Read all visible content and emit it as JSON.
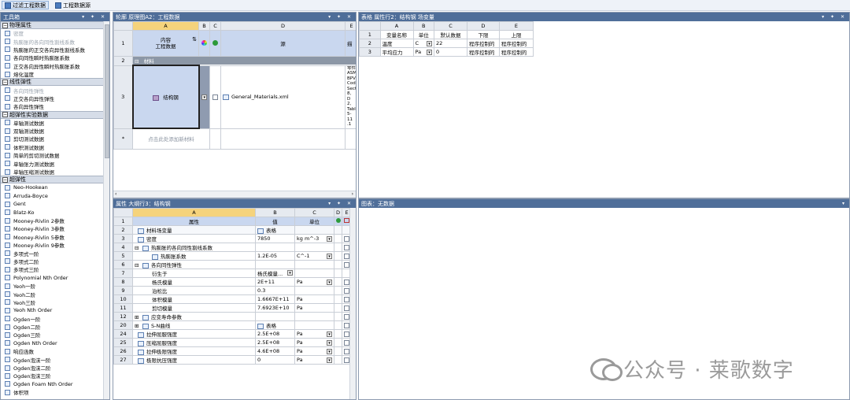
{
  "toolbar": {
    "filter_label": "过滤工程数据",
    "source_label": "工程数据源"
  },
  "toolbox": {
    "title": "工具箱",
    "controls": "▾ ✦ ✕",
    "categories": [
      {
        "label": "物理属性",
        "items": [
          {
            "label": "密度",
            "dim": true
          },
          {
            "label": "热膨胀的各向同性割线系数",
            "dim": true
          },
          {
            "label": "热膨胀的正交各向异性割线系数",
            "dim": false
          },
          {
            "label": "各向同性瞬时热膨胀系数",
            "dim": false
          },
          {
            "label": "正交各向异性瞬时热膨胀系数",
            "dim": false
          },
          {
            "label": "熔化温度",
            "dim": false
          }
        ]
      },
      {
        "label": "线性弹性",
        "items": [
          {
            "label": "各向同性弹性",
            "dim": true
          },
          {
            "label": "正交各向异性弹性",
            "dim": false
          },
          {
            "label": "各向异性弹性",
            "dim": false
          }
        ]
      },
      {
        "label": "超弹性实验数据",
        "items": [
          {
            "label": "单轴测试数据",
            "dim": false
          },
          {
            "label": "双轴测试数据",
            "dim": false
          },
          {
            "label": "剪切测试数据",
            "dim": false
          },
          {
            "label": "体积测试数据",
            "dim": false
          },
          {
            "label": "简单的剪切测试数据",
            "dim": false
          },
          {
            "label": "单轴张力测试数据",
            "dim": false
          },
          {
            "label": "单轴压缩测试数据",
            "dim": false
          }
        ]
      },
      {
        "label": "超弹性",
        "items": [
          {
            "label": "Neo-Hookean",
            "dim": false
          },
          {
            "label": "Arruda-Boyce",
            "dim": false
          },
          {
            "label": "Gent",
            "dim": false
          },
          {
            "label": "Blatz-Ko",
            "dim": false
          },
          {
            "label": "Mooney-Rivlin 2参数",
            "dim": false
          },
          {
            "label": "Mooney-Rivlin 3参数",
            "dim": false
          },
          {
            "label": "Mooney-Rivlin 5参数",
            "dim": false
          },
          {
            "label": "Mooney-Rivlin 9参数",
            "dim": false
          },
          {
            "label": "多项式一阶",
            "dim": false
          },
          {
            "label": "多项式二阶",
            "dim": false
          },
          {
            "label": "多项式三阶",
            "dim": false
          },
          {
            "label": "Polynomial Nth Order",
            "dim": false
          },
          {
            "label": "Yeoh一阶",
            "dim": false
          },
          {
            "label": "Yeoh二阶",
            "dim": false
          },
          {
            "label": "Yeoh三阶",
            "dim": false
          },
          {
            "label": "Yeoh Nth Order",
            "dim": false
          },
          {
            "label": "Ogden一阶",
            "dim": false
          },
          {
            "label": "Ogden二阶",
            "dim": false
          },
          {
            "label": "Ogden三阶",
            "dim": false
          },
          {
            "label": "Ogden Nth Order",
            "dim": false
          },
          {
            "label": "响应函数",
            "dim": false
          },
          {
            "label": "Ogden泡沫一阶",
            "dim": false
          },
          {
            "label": "Ogden泡沫二阶",
            "dim": false
          },
          {
            "label": "Ogden泡沫三阶",
            "dim": false
          },
          {
            "label": "Ogden Foam Nth Order",
            "dim": false
          },
          {
            "label": "体积项",
            "dim": false
          }
        ]
      }
    ]
  },
  "outline": {
    "title": "轮廓 原理图A2：工程数据",
    "controls": "▾ ✦ ✕",
    "cols": [
      "A",
      "B",
      "C",
      "D",
      "E"
    ],
    "header_row": {
      "num": "1",
      "content": "内容\n工程数据",
      "source": "源",
      "desc": "描"
    },
    "row2": {
      "num": "2",
      "label": "材料"
    },
    "row3": {
      "num": "3",
      "material": "结构钢",
      "file": "General_Materials.xml",
      "desc": "零件 ASM BPV Cod Sect 8, D 2, Tabl 5-11 .1"
    },
    "row_add": {
      "num": "*",
      "placeholder": "点击此处添加新材料"
    }
  },
  "table_panel": {
    "title": "表格 属性行2：结构钢 场变量",
    "controls": "▾ ✦ ✕",
    "cols": [
      "A",
      "B",
      "C",
      "D",
      "E"
    ],
    "headers": [
      "变量名称",
      "单位",
      "默认数据",
      "下限",
      "上限"
    ],
    "rows": [
      {
        "num": "2",
        "name": "温度",
        "unit": "C",
        "default": "22",
        "lower": "程序控制的",
        "upper": "程序控制的"
      },
      {
        "num": "3",
        "name": "平均应力",
        "unit": "Pa",
        "default": "0",
        "lower": "程序控制的",
        "upper": "程序控制的"
      }
    ]
  },
  "props": {
    "title": "属性 大纲行3：结构钢",
    "controls": "▾ ✦ ✕",
    "cols": [
      "A",
      "B",
      "C",
      "D",
      "E"
    ],
    "headers": [
      "属性",
      "值",
      "单位"
    ],
    "rows": [
      {
        "num": "2",
        "indent": 0,
        "exp": "",
        "icon": true,
        "label": "材料场变量",
        "value": "表格",
        "value_icon": true,
        "unit": "",
        "unit_dd": false,
        "chk": false
      },
      {
        "num": "3",
        "indent": 0,
        "exp": "",
        "icon": true,
        "label": "密度",
        "value": "7850",
        "value_icon": false,
        "unit": "kg m^-3",
        "unit_dd": true,
        "chk": true
      },
      {
        "num": "4",
        "indent": 0,
        "exp": "⊟",
        "icon": true,
        "label": "热膨胀的各向同性割线系数",
        "value": "",
        "value_icon": false,
        "unit": "",
        "unit_dd": false,
        "chk": true
      },
      {
        "num": "5",
        "indent": 1,
        "exp": "",
        "icon": true,
        "label": "热膨胀系数",
        "value": "1.2E-05",
        "value_icon": false,
        "unit": "C^-1",
        "unit_dd": true,
        "chk": true
      },
      {
        "num": "6",
        "indent": 0,
        "exp": "⊟",
        "icon": true,
        "label": "各向同性弹性",
        "value": "",
        "value_icon": false,
        "unit": "",
        "unit_dd": false,
        "chk": true
      },
      {
        "num": "7",
        "indent": 1,
        "exp": "",
        "icon": false,
        "label": "衍生于",
        "value": "杨氏模量...",
        "value_icon": false,
        "value_dd": true,
        "unit": "",
        "unit_dd": false,
        "chk": false
      },
      {
        "num": "8",
        "indent": 1,
        "exp": "",
        "icon": false,
        "label": "杨氏模量",
        "value": "2E+11",
        "value_icon": false,
        "unit": "Pa",
        "unit_dd": true,
        "chk": true
      },
      {
        "num": "9",
        "indent": 1,
        "exp": "",
        "icon": false,
        "label": "泊松比",
        "value": "0.3",
        "value_icon": false,
        "unit": "",
        "unit_dd": false,
        "chk": true
      },
      {
        "num": "10",
        "indent": 1,
        "exp": "",
        "icon": false,
        "label": "体积模量",
        "value": "1.6667E+11",
        "value_icon": false,
        "unit": "Pa",
        "unit_dd": false,
        "chk": true
      },
      {
        "num": "11",
        "indent": 1,
        "exp": "",
        "icon": false,
        "label": "剪切模量",
        "value": "7.6923E+10",
        "value_icon": false,
        "unit": "Pa",
        "unit_dd": false,
        "chk": true
      },
      {
        "num": "12",
        "indent": 0,
        "exp": "⊞",
        "icon": true,
        "label": "应变寿命参数",
        "value": "",
        "value_icon": false,
        "unit": "",
        "unit_dd": false,
        "chk": true
      },
      {
        "num": "20",
        "indent": 0,
        "exp": "⊞",
        "icon": true,
        "label": "S-N曲线",
        "value": "表格",
        "value_icon": true,
        "unit": "",
        "unit_dd": false,
        "chk": true
      },
      {
        "num": "24",
        "indent": 0,
        "exp": "",
        "icon": true,
        "label": "拉伸屈服强度",
        "value": "2.5E+08",
        "value_icon": false,
        "unit": "Pa",
        "unit_dd": true,
        "chk": true
      },
      {
        "num": "25",
        "indent": 0,
        "exp": "",
        "icon": true,
        "label": "压缩屈服强度",
        "value": "2.5E+08",
        "value_icon": false,
        "unit": "Pa",
        "unit_dd": true,
        "chk": true
      },
      {
        "num": "26",
        "indent": 0,
        "exp": "",
        "icon": true,
        "label": "拉伸极限强度",
        "value": "4.6E+08",
        "value_icon": false,
        "unit": "Pa",
        "unit_dd": true,
        "chk": true
      },
      {
        "num": "27",
        "indent": 0,
        "exp": "",
        "icon": true,
        "label": "极限抗压强度",
        "value": "0",
        "value_icon": false,
        "unit": "Pa",
        "unit_dd": true,
        "chk": true
      }
    ]
  },
  "chart_panel": {
    "title": "图表：无数据",
    "controls": "▾"
  },
  "watermark": {
    "text": "公众号 · 莱歌数字"
  }
}
